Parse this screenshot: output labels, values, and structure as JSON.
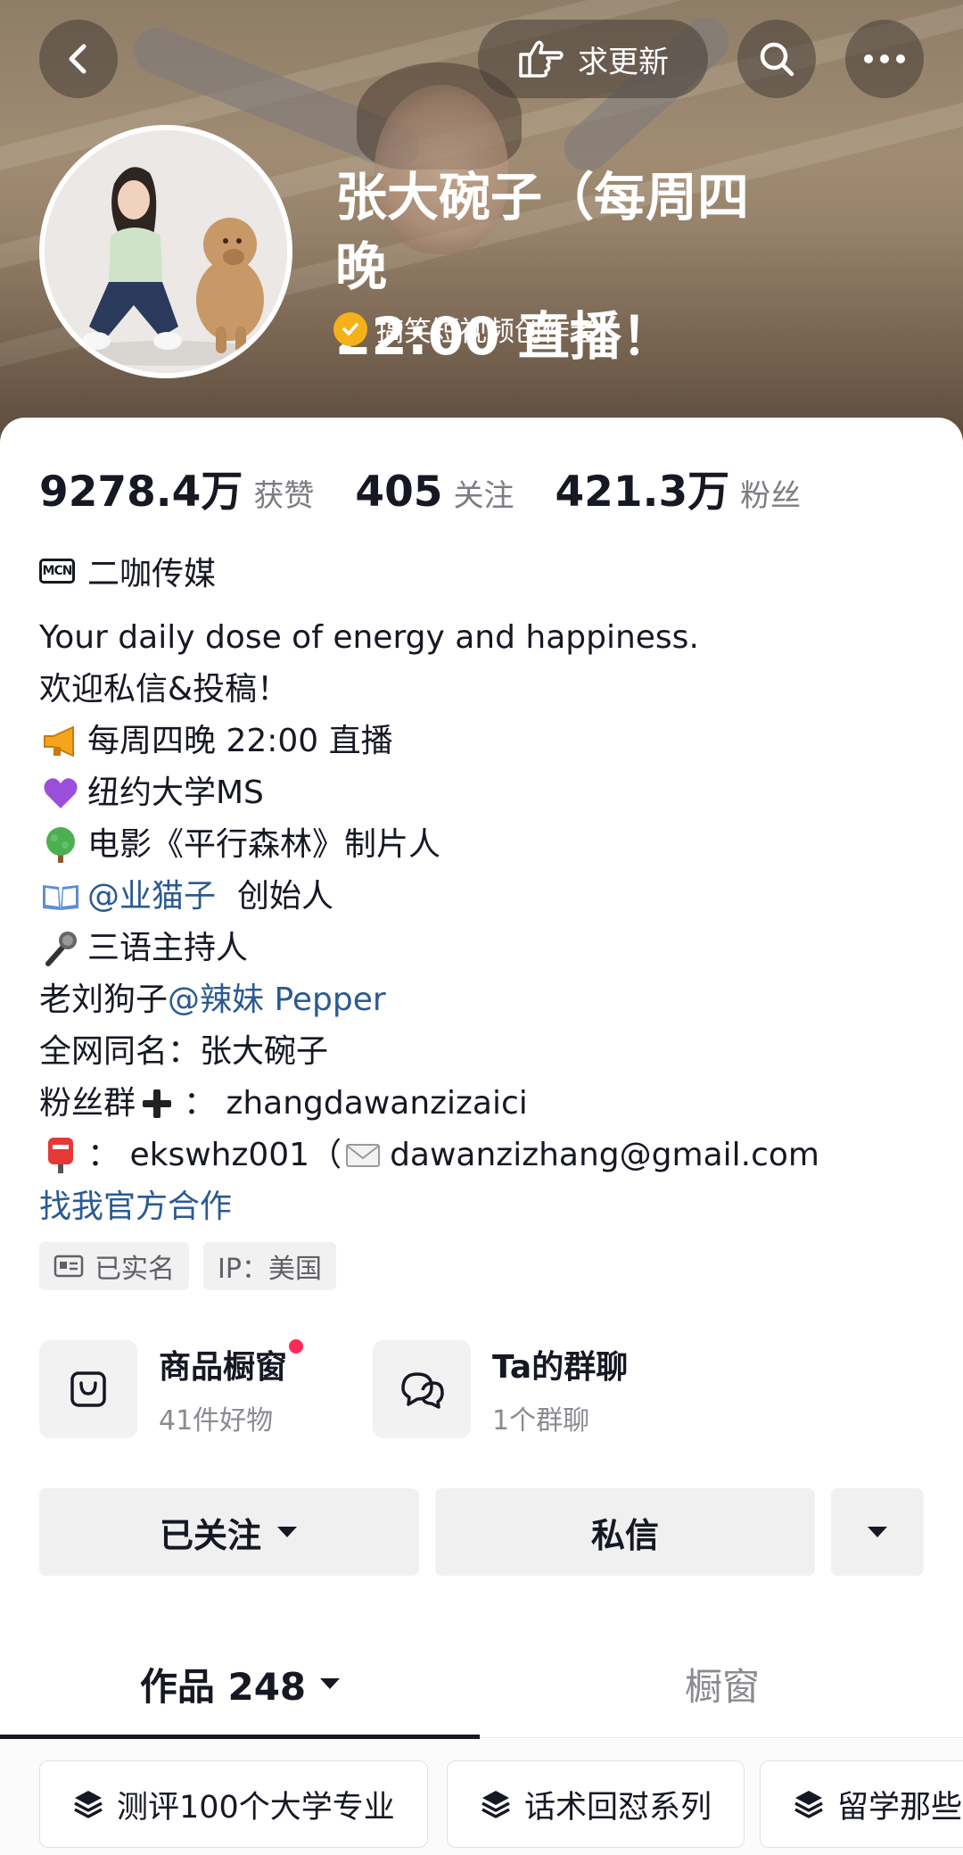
{
  "header": {
    "request_update_label": "求更新",
    "name_line1": "张大碗子（每周四晚",
    "name_line2": "22:00 直播！",
    "certification": "搞笑短视频创作者"
  },
  "stats": [
    {
      "value": "9278.4万",
      "label": "获赞"
    },
    {
      "value": "405",
      "label": "关注"
    },
    {
      "value": "421.3万",
      "label": "粉丝"
    }
  ],
  "mcn": {
    "icon_text": "MCN",
    "name": "二咖传媒"
  },
  "bio": {
    "line1": "Your daily dose of energy and happiness.",
    "line2": "欢迎私信&投稿！",
    "line3": "每周四晚 22:00 直播",
    "line4": "纽约大学MS",
    "line5": "电影《平行森林》制片人",
    "line6_link": "@业猫子",
    "line6_text": "创始人",
    "line7": "三语主持人",
    "line8_prefix": "老刘狗子",
    "line8_link": "@辣妹 Pepper",
    "line9": "全网同名：张大碗子",
    "line10_prefix": "粉丝群",
    "line10_suffix": "：  zhangdawanzizaici",
    "line11_prefix": "：  ekswhz001（",
    "line11_email": "dawanzizhang@gmail.com",
    "cooperation_link": "找我官方合作"
  },
  "tags": {
    "real_name": "已实名",
    "ip": "IP：美国"
  },
  "features": {
    "shop_title": "商品橱窗",
    "shop_sub": "41件好物",
    "group_title": "Ta的群聊",
    "group_sub": "1个群聊"
  },
  "actions": {
    "followed": "已关注",
    "message": "私信"
  },
  "tabs": {
    "works": "作品 248",
    "showcase": "橱窗"
  },
  "collections": [
    "测评100个大学专业",
    "话术回怼系列",
    "留学那些事"
  ],
  "colors": {
    "link": "#2b5a91",
    "badge": "#f5b119",
    "dot": "#fe2c55"
  }
}
